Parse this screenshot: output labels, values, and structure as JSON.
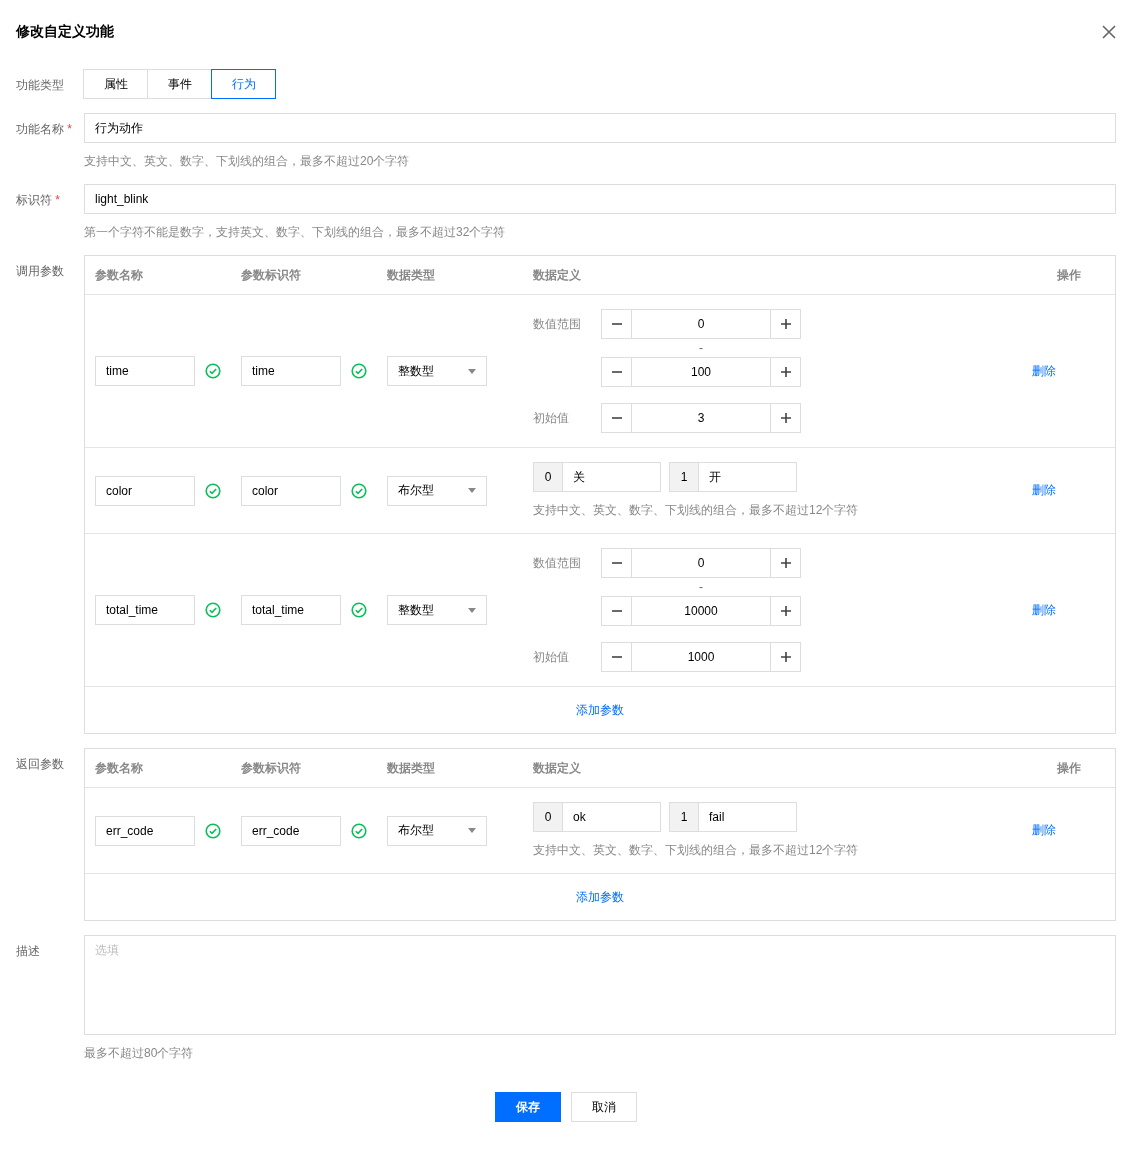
{
  "dialog": {
    "title": "修改自定义功能"
  },
  "type_field": {
    "label": "功能类型",
    "options": [
      {
        "label": "属性",
        "selected": false
      },
      {
        "label": "事件",
        "selected": false
      },
      {
        "label": "行为",
        "selected": true
      }
    ]
  },
  "name_field": {
    "label": "功能名称",
    "required_mark": "*",
    "value": "行为动作",
    "hint": "支持中文、英文、数字、下划线的组合，最多不超过20个字符"
  },
  "id_field": {
    "label": "标识符",
    "required_mark": "*",
    "value": "light_blink",
    "hint": "第一个字符不能是数字，支持英文、数字、下划线的组合，最多不超过32个字符"
  },
  "input_params": {
    "label": "调用参数",
    "columns": [
      "参数名称",
      "参数标识符",
      "数据类型",
      "数据定义",
      "操作"
    ],
    "rows": [
      {
        "kind": "int",
        "name": "time",
        "identifier": "time",
        "type": "整数型",
        "range_label": "数值范围",
        "min": "0",
        "separator": "-",
        "max": "100",
        "initial_label": "初始值",
        "initial": "3",
        "action": "删除"
      },
      {
        "kind": "bool",
        "name": "color",
        "identifier": "color",
        "type": "布尔型",
        "false_key": "0",
        "false_text": "关",
        "true_key": "1",
        "true_text": "开",
        "hint": "支持中文、英文、数字、下划线的组合，最多不超过12个字符",
        "action": "删除"
      },
      {
        "kind": "int",
        "name": "total_time",
        "identifier": "total_time",
        "type": "整数型",
        "range_label": "数值范围",
        "min": "0",
        "separator": "-",
        "max": "10000",
        "initial_label": "初始值",
        "initial": "1000",
        "action": "删除"
      }
    ],
    "add": "添加参数"
  },
  "output_params": {
    "label": "返回参数",
    "columns": [
      "参数名称",
      "参数标识符",
      "数据类型",
      "数据定义",
      "操作"
    ],
    "rows": [
      {
        "kind": "bool",
        "name": "err_code",
        "identifier": "err_code",
        "type": "布尔型",
        "false_key": "0",
        "false_text": "ok",
        "true_key": "1",
        "true_text": "fail",
        "hint": "支持中文、英文、数字、下划线的组合，最多不超过12个字符",
        "action": "删除"
      }
    ],
    "add": "添加参数"
  },
  "description": {
    "label": "描述",
    "placeholder": "选填",
    "hint": "最多不超过80个字符"
  },
  "buttons": [
    {
      "label": "保存",
      "kind": "primary"
    },
    {
      "label": "取消",
      "kind": "default"
    }
  ]
}
